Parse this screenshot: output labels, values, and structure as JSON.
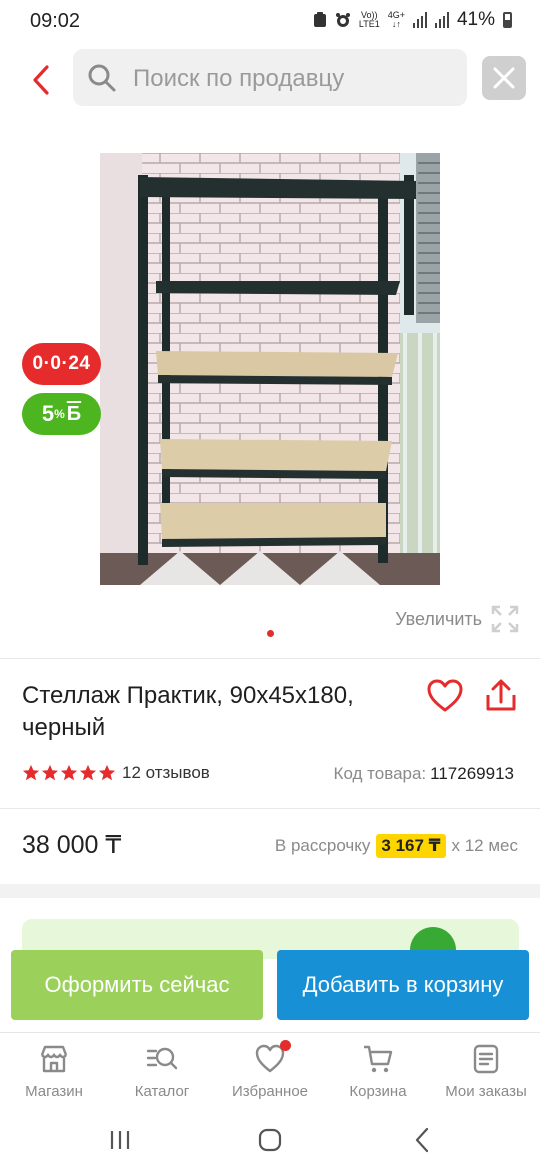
{
  "status_bar": {
    "time": "09:02",
    "volte_line1": "Vo))",
    "volte_line2": "LTE1",
    "network": "4G+",
    "battery": "41%"
  },
  "search": {
    "placeholder": "Поиск по продавцу"
  },
  "badges": {
    "timer": "0·0·24",
    "bonus_value": "5",
    "bonus_percent": "%",
    "bonus_currency": "Б"
  },
  "zoom_label": "Увеличить",
  "gallery": {
    "current": 1,
    "total": 1
  },
  "product": {
    "title": "Стеллаж Практик, 90x45x180, черный",
    "rating": 5,
    "reviews": "12 отзывов",
    "sku_label": "Код товара:",
    "sku_value": "117269913",
    "price": "38 000 ₸",
    "installment_label": "В рассрочку",
    "installment_amount": "3 167 ₸",
    "installment_term": "x 12 мес"
  },
  "actions": {
    "checkout": "Оформить сейчас",
    "add_to_cart": "Добавить в корзину"
  },
  "bottom_nav": [
    {
      "label": "Магазин",
      "icon": "store-icon"
    },
    {
      "label": "Каталог",
      "icon": "catalog-search-icon"
    },
    {
      "label": "Избранное",
      "icon": "heart-icon"
    },
    {
      "label": "Корзина",
      "icon": "cart-icon"
    },
    {
      "label": "Мои заказы",
      "icon": "orders-icon"
    }
  ],
  "colors": {
    "accent_red": "#e52b2b",
    "bonus_green": "#4cb51f",
    "checkout_green": "#9bd15a",
    "cart_blue": "#1790d6",
    "installment_yellow": "#ffd500"
  }
}
